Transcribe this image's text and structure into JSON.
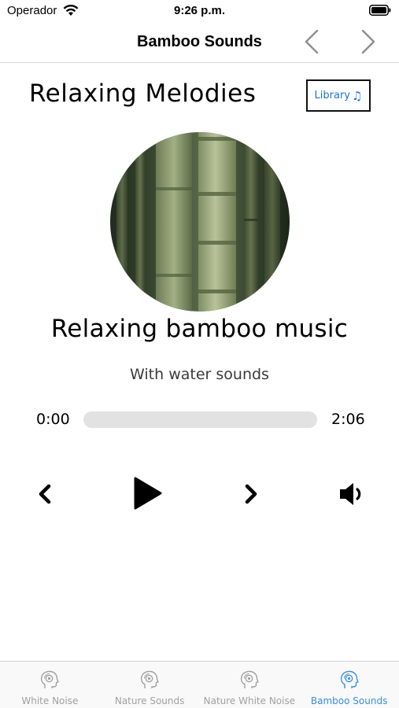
{
  "status_bar": {
    "carrier": "Operador",
    "time": "9:26 p.m."
  },
  "nav": {
    "title": "Bamboo Sounds"
  },
  "header": {
    "section_title": "Relaxing Melodies",
    "library_label": "Library",
    "library_icon": "music-note-icon"
  },
  "track": {
    "title": "Relaxing bamboo music",
    "subtitle": "With water sounds",
    "artwork": "bamboo-stalks-image"
  },
  "player": {
    "current_time": "0:00",
    "total_time": "2:06",
    "progress": 0.0
  },
  "tabs": [
    {
      "label": "White Noise",
      "icon": "sound-head-icon",
      "active": false
    },
    {
      "label": "Nature Sounds",
      "icon": "sound-head-icon",
      "active": false
    },
    {
      "label": "Nature White Noise",
      "icon": "sound-head-icon",
      "active": false
    },
    {
      "label": "Bamboo Sounds",
      "icon": "sound-head-icon",
      "active": true
    }
  ],
  "colors": {
    "accent": "#3d8fd8",
    "library_text": "#1a73d9",
    "tab_inactive": "#a0a0a0",
    "progress_track": "#e2e2e2"
  }
}
